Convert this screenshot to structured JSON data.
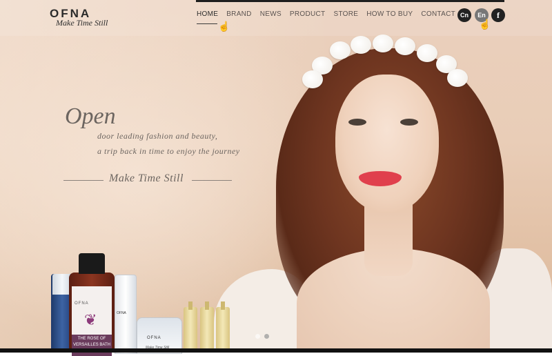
{
  "header": {
    "logo": {
      "word": "OFNA",
      "tagline": "Make Time Still"
    },
    "nav": [
      {
        "label": "HOME",
        "active": true
      },
      {
        "label": "BRAND"
      },
      {
        "label": "NEWS"
      },
      {
        "label": "PRODUCT"
      },
      {
        "label": "STORE"
      },
      {
        "label": "HOW TO BUY"
      },
      {
        "label": "CONTACT"
      }
    ],
    "languages": {
      "cn": "Cn",
      "en": "En"
    },
    "social": {
      "facebook": "f"
    }
  },
  "hero": {
    "headline": "Open",
    "line1": "door leading fashion and beauty,",
    "line2": "a trip back in time to enjoy the journey",
    "slogan": "Make Time Still"
  },
  "products": {
    "bath_milk_brand": "OFNA",
    "bath_milk_label": "THE ROSE OF VERSAILLES BATH MILK",
    "serum_brand": "OFNA",
    "jar_brand": "OFNA",
    "jar_tagline": "Make Time Still"
  },
  "slider": {
    "count": 2,
    "active": 2
  },
  "colors": {
    "text": "#6c6560",
    "nav": "#5a5350",
    "dark": "#222222"
  }
}
